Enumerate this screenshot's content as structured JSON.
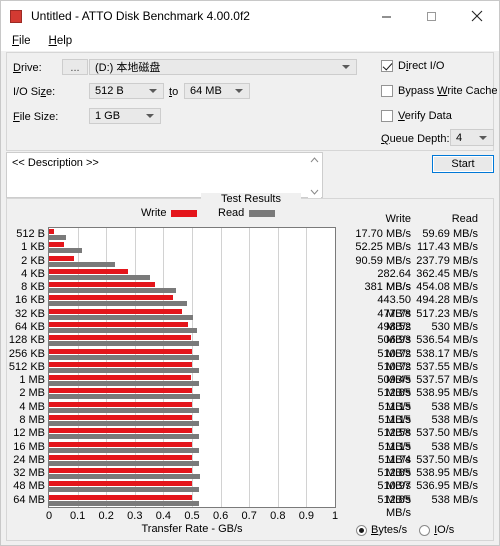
{
  "window": {
    "title": "Untitled - ATTO Disk Benchmark 4.00.0f2",
    "app_icon": "atto-app-icon",
    "minimize": "–",
    "maximize": "□",
    "close": "✕"
  },
  "menu": {
    "items": [
      {
        "label": "File",
        "accel": "F"
      },
      {
        "label": "Help",
        "accel": "H"
      }
    ]
  },
  "settings": {
    "drive_label": "Drive:",
    "drive_browse": "...",
    "drive_value": "(D:) 本地磁盘",
    "io_size_label": "I/O Size:",
    "io_size_from": "512 B",
    "io_size_to_label": "to",
    "io_size_to": "64 MB",
    "file_size_label": "File Size:",
    "file_size_value": "1 GB",
    "direct_io_label": "Direct I/O",
    "direct_io_checked": true,
    "bypass_cache_label": "Bypass Write Cache",
    "bypass_cache_checked": false,
    "verify_data_label": "Verify Data",
    "verify_data_checked": false,
    "queue_depth_label": "Queue Depth:",
    "queue_depth_value": "4",
    "description_value": "<< Description >>",
    "start_label": "Start"
  },
  "results": {
    "title": "Test Results",
    "legend_write": "Write",
    "legend_read": "Read",
    "legend_write_color": "#e4151b",
    "legend_read_color": "#7a7a7a",
    "col_write": "Write",
    "col_read": "Read",
    "units_bytes": "Bytes/s",
    "units_io": "IO/s",
    "units_selected": "Bytes/s"
  },
  "chart_data": {
    "type": "bar",
    "title": "Test Results",
    "xlabel": "Transfer Rate - GB/s",
    "ylabel": "",
    "xlim": [
      0,
      1
    ],
    "xticks": [
      "0",
      "0.1",
      "0.2",
      "0.3",
      "0.4",
      "0.5",
      "0.6",
      "0.7",
      "0.8",
      "0.9",
      "1"
    ],
    "grid": true,
    "legend_position": "top",
    "orientation": "horizontal",
    "unit": "MB/s",
    "categories": [
      "512 B",
      "1 KB",
      "2 KB",
      "4 KB",
      "8 KB",
      "16 KB",
      "32 KB",
      "64 KB",
      "128 KB",
      "256 KB",
      "512 KB",
      "1 MB",
      "2 MB",
      "4 MB",
      "8 MB",
      "12 MB",
      "16 MB",
      "24 MB",
      "32 MB",
      "48 MB",
      "64 MB"
    ],
    "series": [
      {
        "name": "Write",
        "color": "#e4151b",
        "values": [
          17.7,
          52.25,
          90.59,
          282.64,
          381,
          443.5,
          477.78,
          498.52,
          506.93,
          510.72,
          510.72,
          509.45,
          512.85,
          511.15,
          511.15,
          512.58,
          511.15,
          511.74,
          512.85,
          510.97,
          512.85
        ],
        "labels": [
          "17.70 MB/s",
          "52.25 MB/s",
          "90.59 MB/s",
          "282.64 MB/s",
          "381 MB/s",
          "443.50 MB/s",
          "477.78 MB/s",
          "498.52 MB/s",
          "506.93 MB/s",
          "510.72 MB/s",
          "510.72 MB/s",
          "509.45 MB/s",
          "512.85 MB/s",
          "511.15 MB/s",
          "511.15 MB/s",
          "512.58 MB/s",
          "511.15 MB/s",
          "511.74 MB/s",
          "512.85 MB/s",
          "510.97 MB/s",
          "512.85 MB/s"
        ]
      },
      {
        "name": "Read",
        "color": "#7a7a7a",
        "values": [
          59.69,
          117.43,
          237.79,
          362.45,
          454.08,
          494.28,
          517.23,
          530,
          536.54,
          538.17,
          537.55,
          537.57,
          538.95,
          538,
          538,
          537.5,
          538,
          537.5,
          538.95,
          536.95,
          538
        ],
        "labels": [
          "59.69 MB/s",
          "117.43 MB/s",
          "237.79 MB/s",
          "362.45 MB/s",
          "454.08 MB/s",
          "494.28 MB/s",
          "517.23 MB/s",
          "530 MB/s",
          "536.54 MB/s",
          "538.17 MB/s",
          "537.55 MB/s",
          "537.57 MB/s",
          "538.95 MB/s",
          "538 MB/s",
          "538 MB/s",
          "537.50 MB/s",
          "538 MB/s",
          "537.50 MB/s",
          "538.95 MB/s",
          "536.95 MB/s",
          "538 MB/s"
        ]
      }
    ]
  }
}
